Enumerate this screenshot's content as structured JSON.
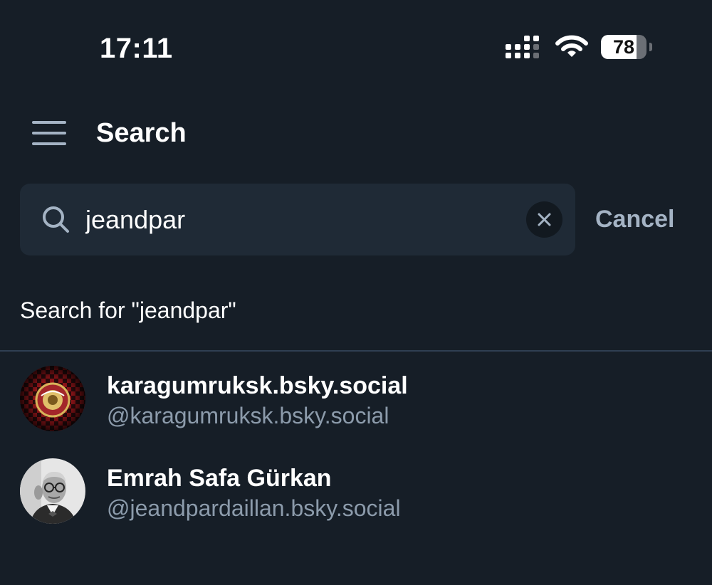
{
  "status_bar": {
    "time": "17:11",
    "battery_level": "78",
    "signal_icon": "cellular-signal-icon",
    "wifi_icon": "wifi-icon",
    "battery_icon": "battery-icon"
  },
  "header": {
    "title": "Search",
    "menu_icon": "hamburger-menu-icon"
  },
  "search": {
    "value": "jeandpar",
    "search_icon": "magnifier-icon",
    "clear_icon": "close-icon",
    "cancel_label": "Cancel",
    "search_for_label": "Search for \"jeandpar\""
  },
  "results": [
    {
      "display_name": "karagumruksk.bsky.social",
      "handle": "@karagumruksk.bsky.social"
    },
    {
      "display_name": "Emrah Safa Gürkan",
      "handle": "@jeandpardaillan.bsky.social"
    }
  ],
  "colors": {
    "background": "#161e27",
    "search_field": "#1f2a36",
    "accent_muted": "#a4b3c4",
    "handle_text": "#8c9bab",
    "divider": "#2f3f52"
  }
}
